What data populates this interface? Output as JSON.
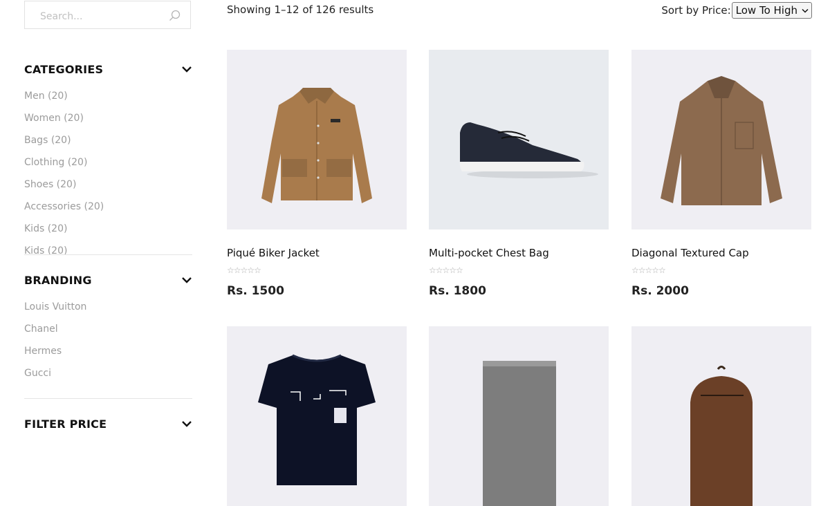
{
  "search": {
    "placeholder": "Search..."
  },
  "categories": {
    "title": "CATEGORIES",
    "items": [
      "Men (20)",
      "Women (20)",
      "Bags (20)",
      "Clothing (20)",
      "Shoes (20)",
      "Accessories (20)",
      "Kids (20)",
      "Kids (20)"
    ]
  },
  "branding": {
    "title": "BRANDING",
    "items": [
      "Louis Vuitton",
      "Chanel",
      "Hermes",
      "Gucci"
    ]
  },
  "filter_price": {
    "title": "FILTER PRICE"
  },
  "results": {
    "text": "Showing 1–12 of 126 results"
  },
  "sort": {
    "label": "Sort by Price:",
    "selected": "Low To High"
  },
  "products": [
    {
      "name": "Piqué Biker Jacket",
      "stars": "☆☆☆☆☆",
      "price": "Rs. 1500",
      "image": "jacket"
    },
    {
      "name": "Multi-pocket Chest Bag",
      "stars": "☆☆☆☆☆",
      "price": "Rs. 1800",
      "image": "sneaker"
    },
    {
      "name": "Diagonal Textured Cap",
      "stars": "☆☆☆☆☆",
      "price": "Rs. 2000",
      "image": "shirt"
    },
    {
      "name": "",
      "stars": "",
      "price": "",
      "image": "tshirt"
    },
    {
      "name": "",
      "stars": "",
      "price": "",
      "image": "scarf"
    },
    {
      "name": "",
      "stars": "",
      "price": "",
      "image": "backpack"
    }
  ]
}
